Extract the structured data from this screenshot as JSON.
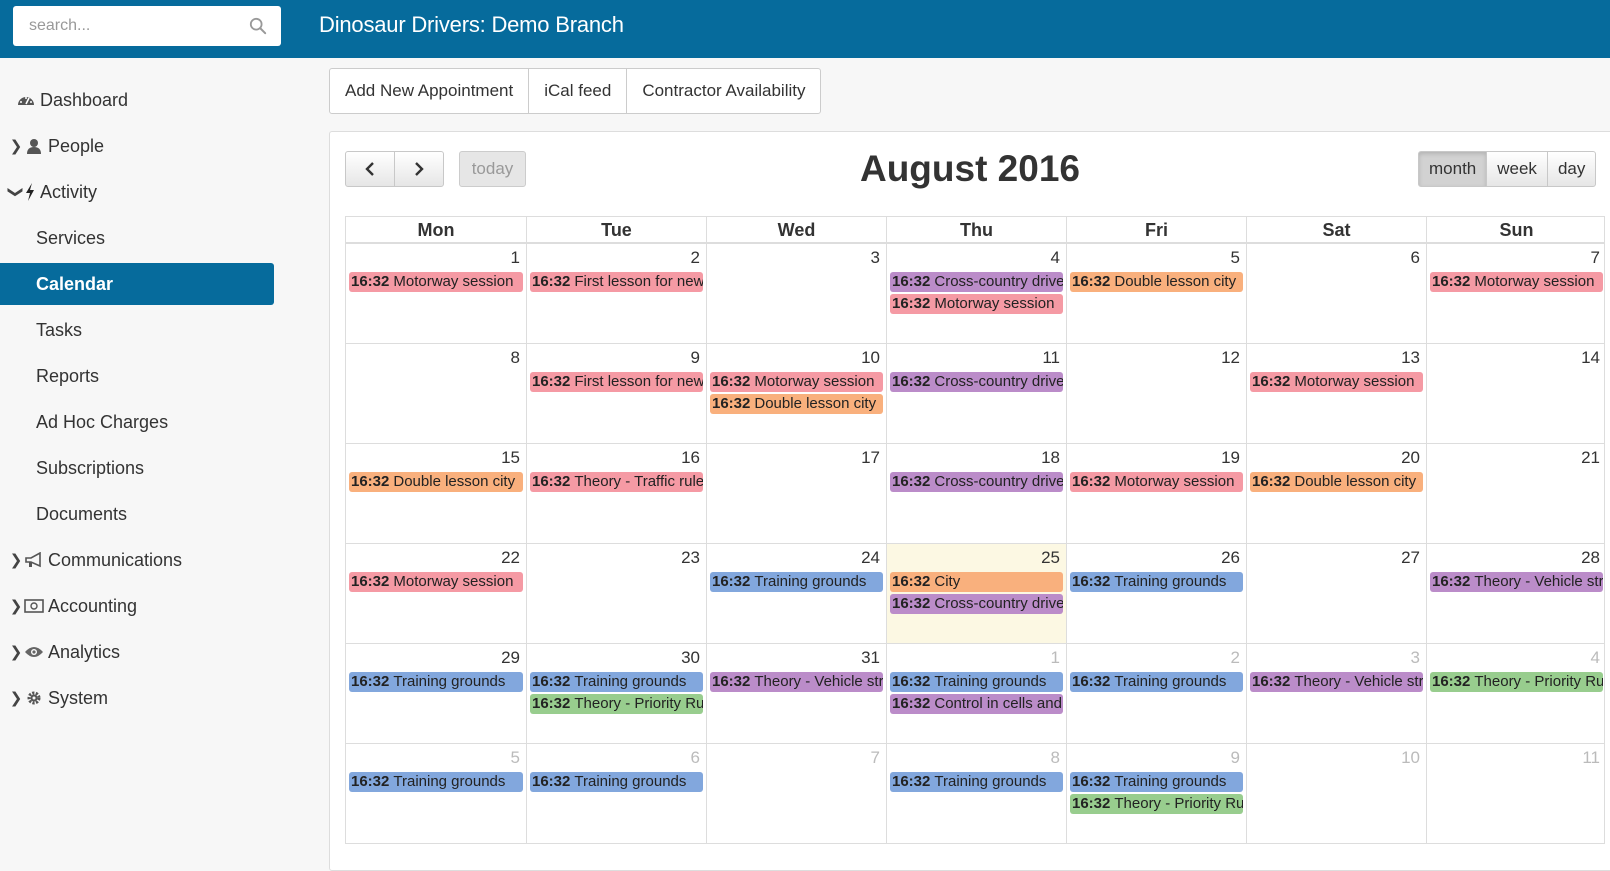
{
  "search": {
    "placeholder": "search..."
  },
  "brand": {
    "title": "Dinosaur Drivers: Demo Branch"
  },
  "sidebar": {
    "items": [
      {
        "label": "Dashboard"
      },
      {
        "label": "People"
      },
      {
        "label": "Activity"
      },
      {
        "label": "Services"
      },
      {
        "label": "Calendar"
      },
      {
        "label": "Tasks"
      },
      {
        "label": "Reports"
      },
      {
        "label": "Ad Hoc Charges"
      },
      {
        "label": "Subscriptions"
      },
      {
        "label": "Documents"
      },
      {
        "label": "Communications"
      },
      {
        "label": "Accounting"
      },
      {
        "label": "Analytics"
      },
      {
        "label": "System"
      }
    ]
  },
  "toolbar": {
    "add_label": "Add New Appointment",
    "ical_label": "iCal feed",
    "contractor_label": "Contractor Availability"
  },
  "calendar": {
    "title": "August 2016",
    "today_label": "today",
    "views": [
      "month",
      "week",
      "day"
    ],
    "active_view": "month",
    "headers": [
      "Mon",
      "Tue",
      "Wed",
      "Thu",
      "Fri",
      "Sat",
      "Sun"
    ],
    "colors": {
      "pink": "#f59aa4",
      "orange": "#f9b07d",
      "purple": "#bb8cc9",
      "blue": "#82a7dd",
      "green": "#98cd8e",
      "today_bg": "#fcf8e3"
    },
    "weeks": [
      [
        {
          "num": "1",
          "events": [
            {
              "time": "16:32",
              "title": "Motorway session",
              "color": "pink"
            }
          ]
        },
        {
          "num": "2",
          "events": [
            {
              "time": "16:32",
              "title": "First lesson for new",
              "color": "pink"
            }
          ]
        },
        {
          "num": "3",
          "events": []
        },
        {
          "num": "4",
          "events": [
            {
              "time": "16:32",
              "title": "Cross-country drive",
              "color": "purple"
            },
            {
              "time": "16:32",
              "title": "Motorway session",
              "color": "pink"
            }
          ]
        },
        {
          "num": "5",
          "events": [
            {
              "time": "16:32",
              "title": "Double lesson city",
              "color": "orange"
            }
          ]
        },
        {
          "num": "6",
          "events": []
        },
        {
          "num": "7",
          "events": [
            {
              "time": "16:32",
              "title": "Motorway session",
              "color": "pink"
            }
          ]
        }
      ],
      [
        {
          "num": "8",
          "events": []
        },
        {
          "num": "9",
          "events": [
            {
              "time": "16:32",
              "title": "First lesson for new",
              "color": "pink"
            }
          ]
        },
        {
          "num": "10",
          "events": [
            {
              "time": "16:32",
              "title": "Motorway session",
              "color": "pink"
            },
            {
              "time": "16:32",
              "title": "Double lesson city",
              "color": "orange"
            }
          ]
        },
        {
          "num": "11",
          "events": [
            {
              "time": "16:32",
              "title": "Cross-country drive",
              "color": "purple"
            }
          ]
        },
        {
          "num": "12",
          "events": []
        },
        {
          "num": "13",
          "events": [
            {
              "time": "16:32",
              "title": "Motorway session",
              "color": "pink"
            }
          ]
        },
        {
          "num": "14",
          "events": []
        }
      ],
      [
        {
          "num": "15",
          "events": [
            {
              "time": "16:32",
              "title": "Double lesson city",
              "color": "orange"
            }
          ]
        },
        {
          "num": "16",
          "events": [
            {
              "time": "16:32",
              "title": "Theory - Traffic rule",
              "color": "pink"
            }
          ]
        },
        {
          "num": "17",
          "events": []
        },
        {
          "num": "18",
          "events": [
            {
              "time": "16:32",
              "title": "Cross-country drive",
              "color": "purple"
            }
          ]
        },
        {
          "num": "19",
          "events": [
            {
              "time": "16:32",
              "title": "Motorway session",
              "color": "pink"
            }
          ]
        },
        {
          "num": "20",
          "events": [
            {
              "time": "16:32",
              "title": "Double lesson city",
              "color": "orange"
            }
          ]
        },
        {
          "num": "21",
          "events": []
        }
      ],
      [
        {
          "num": "22",
          "events": [
            {
              "time": "16:32",
              "title": "Motorway session",
              "color": "pink"
            }
          ]
        },
        {
          "num": "23",
          "events": []
        },
        {
          "num": "24",
          "events": [
            {
              "time": "16:32",
              "title": "Training grounds",
              "color": "blue"
            }
          ]
        },
        {
          "num": "25",
          "today": true,
          "events": [
            {
              "time": "16:32",
              "title": "City",
              "color": "orange"
            },
            {
              "time": "16:32",
              "title": "Cross-country drive",
              "color": "purple"
            }
          ]
        },
        {
          "num": "26",
          "events": [
            {
              "time": "16:32",
              "title": "Training grounds",
              "color": "blue"
            }
          ]
        },
        {
          "num": "27",
          "events": []
        },
        {
          "num": "28",
          "events": [
            {
              "time": "16:32",
              "title": "Theory - Vehicle str",
              "color": "purple"
            }
          ]
        }
      ],
      [
        {
          "num": "29",
          "events": [
            {
              "time": "16:32",
              "title": "Training grounds",
              "color": "blue"
            }
          ]
        },
        {
          "num": "30",
          "events": [
            {
              "time": "16:32",
              "title": "Training grounds",
              "color": "blue"
            },
            {
              "time": "16:32",
              "title": "Theory - Priority Ru",
              "color": "green"
            }
          ]
        },
        {
          "num": "31",
          "events": [
            {
              "time": "16:32",
              "title": "Theory - Vehicle str",
              "color": "purple"
            }
          ]
        },
        {
          "num": "1",
          "other": true,
          "events": [
            {
              "time": "16:32",
              "title": "Training grounds",
              "color": "blue"
            },
            {
              "time": "16:32",
              "title": "Control in cells and",
              "color": "purple"
            }
          ]
        },
        {
          "num": "2",
          "other": true,
          "events": [
            {
              "time": "16:32",
              "title": "Training grounds",
              "color": "blue"
            }
          ]
        },
        {
          "num": "3",
          "other": true,
          "events": [
            {
              "time": "16:32",
              "title": "Theory - Vehicle str",
              "color": "purple"
            }
          ]
        },
        {
          "num": "4",
          "other": true,
          "events": [
            {
              "time": "16:32",
              "title": "Theory - Priority Ru",
              "color": "green"
            }
          ]
        }
      ],
      [
        {
          "num": "5",
          "other": true,
          "events": [
            {
              "time": "16:32",
              "title": "Training grounds",
              "color": "blue"
            }
          ]
        },
        {
          "num": "6",
          "other": true,
          "events": [
            {
              "time": "16:32",
              "title": "Training grounds",
              "color": "blue"
            }
          ]
        },
        {
          "num": "7",
          "other": true,
          "events": []
        },
        {
          "num": "8",
          "other": true,
          "events": [
            {
              "time": "16:32",
              "title": "Training grounds",
              "color": "blue"
            }
          ]
        },
        {
          "num": "9",
          "other": true,
          "events": [
            {
              "time": "16:32",
              "title": "Training grounds",
              "color": "blue"
            },
            {
              "time": "16:32",
              "title": "Theory - Priority Ru",
              "color": "green"
            }
          ]
        },
        {
          "num": "10",
          "other": true,
          "events": []
        },
        {
          "num": "11",
          "other": true,
          "events": []
        }
      ]
    ]
  }
}
